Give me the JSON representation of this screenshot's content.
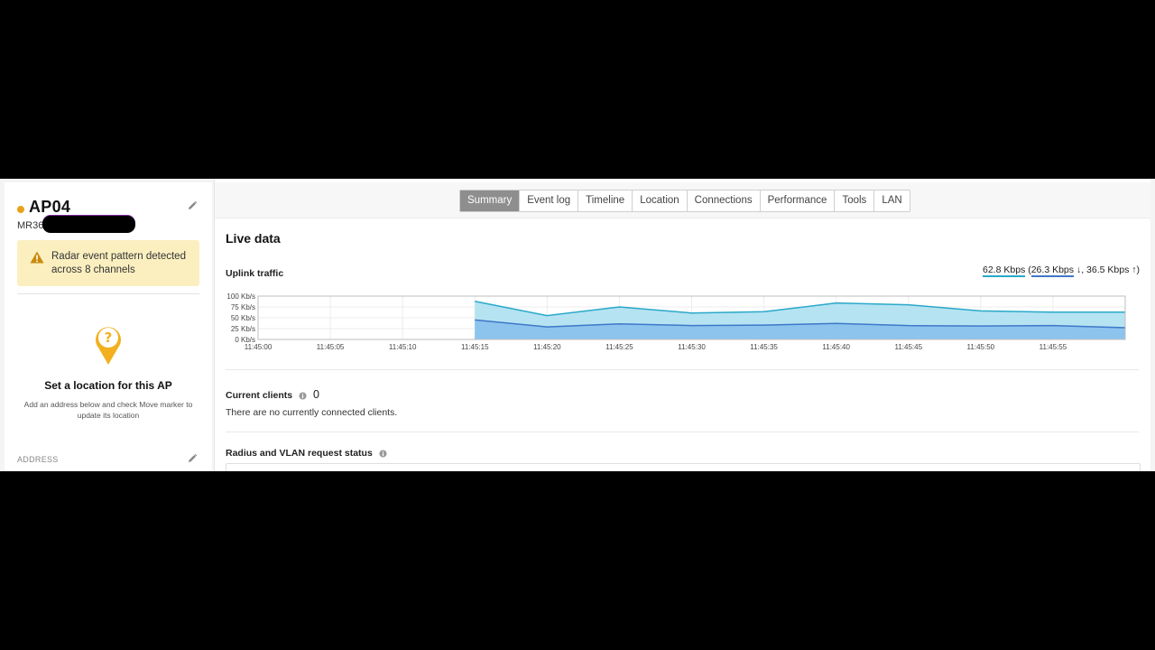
{
  "device": {
    "name": "AP04",
    "model_prefix": "MR36",
    "status_color": "#e8a21a"
  },
  "alert": {
    "message": "Radar event pattern detected across 8 channels",
    "icon": "warning-icon"
  },
  "location": {
    "title": "Set a location for this AP",
    "description": "Add an address below and check Move marker to update its location",
    "address_label": "ADDRESS",
    "icon": "location-pin-question-icon"
  },
  "tabs": [
    {
      "label": "Summary",
      "active": true
    },
    {
      "label": "Event log"
    },
    {
      "label": "Timeline"
    },
    {
      "label": "Location"
    },
    {
      "label": "Connections"
    },
    {
      "label": "Performance"
    },
    {
      "label": "Tools"
    },
    {
      "label": "LAN"
    }
  ],
  "live_data": {
    "title": "Live data",
    "uplink_title": "Uplink traffic",
    "total_rate": "62.8 Kbps",
    "down_rate": "26.3 Kbps",
    "up_rate": "36.5 Kbps"
  },
  "chart_data": {
    "type": "area",
    "y_tick_labels": [
      "100 Kb/s",
      "75 Kb/s",
      "50 Kb/s",
      "25 Kb/s",
      "0 Kb/s"
    ],
    "y_ticks": [
      100,
      75,
      50,
      25,
      0
    ],
    "ylim": [
      0,
      100
    ],
    "x_tick_labels": [
      "11:45:00",
      "11:45:05",
      "11:45:10",
      "11:45:15",
      "11:45:20",
      "11:45:25",
      "11:45:30",
      "11:45:35",
      "11:45:40",
      "11:45:45",
      "11:45:50",
      "11:45:55"
    ],
    "x_range_seconds": [
      0,
      60
    ],
    "grid": true,
    "series": [
      {
        "color": "#2aa8c8",
        "x": [
          15,
          20,
          25,
          30,
          35,
          40,
          45,
          50,
          55,
          60
        ],
        "values": [
          88,
          55,
          75,
          61,
          64,
          84,
          80,
          66,
          63,
          63
        ]
      },
      {
        "color": "#3f78c8",
        "x": [
          15,
          20,
          25,
          30,
          35,
          40,
          45,
          50,
          55,
          60
        ],
        "values": [
          45,
          29,
          36,
          32,
          33,
          37,
          32,
          31,
          32,
          27
        ]
      }
    ]
  },
  "clients": {
    "title": "Current clients",
    "count": "0",
    "empty_message": "There are no currently connected clients."
  },
  "radius": {
    "title": "Radius and VLAN request status"
  }
}
